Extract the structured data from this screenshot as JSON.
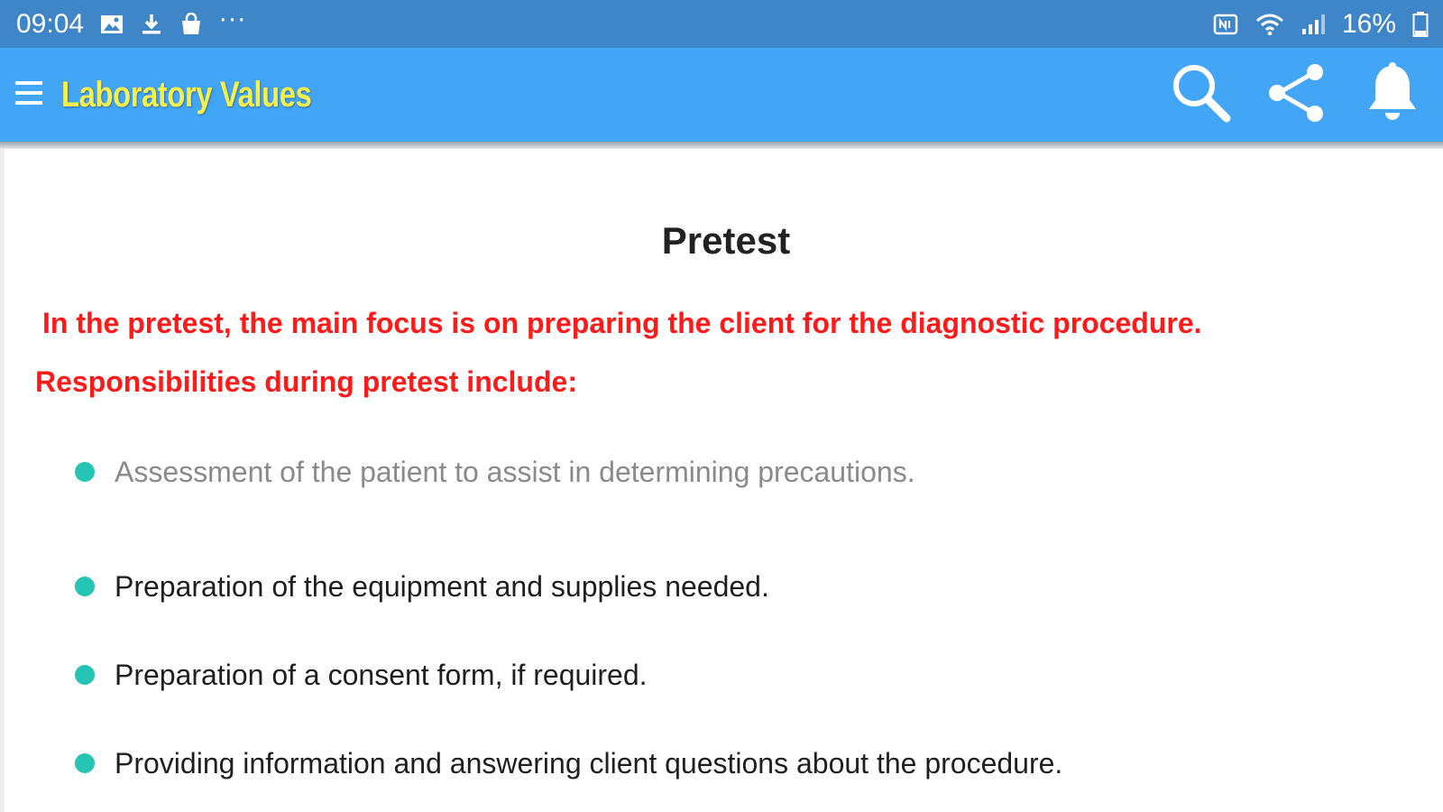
{
  "status_bar": {
    "time": "09:04",
    "left_icons": [
      "image-icon",
      "download-icon",
      "bag-icon"
    ],
    "more": "···",
    "right_icons": [
      "nfc-icon",
      "wifi-icon",
      "signal-icon"
    ],
    "battery": "16%"
  },
  "app_bar": {
    "title": "Laboratory Values",
    "menu_icon": "hamburger-menu-icon",
    "actions": [
      "search-icon",
      "share-icon",
      "bell-icon"
    ],
    "colors": {
      "bar": "#42a5f5",
      "title": "#f7f04a",
      "status": "#3f86c8"
    }
  },
  "content": {
    "title": "Pretest",
    "intro": "In the pretest, the main focus is on preparing the client for the diagnostic procedure.",
    "responsibilities_heading": "Responsibilities during pretest include:",
    "bullets": [
      "Assessment of the patient to assist in determining precautions.",
      "Preparation of the equipment and supplies needed.",
      "Preparation of a consent form, if required.",
      "Providing information and answering client questions about the procedure."
    ],
    "colors": {
      "highlight": "#ff1a1a",
      "bullet": "#25c4b3"
    }
  }
}
